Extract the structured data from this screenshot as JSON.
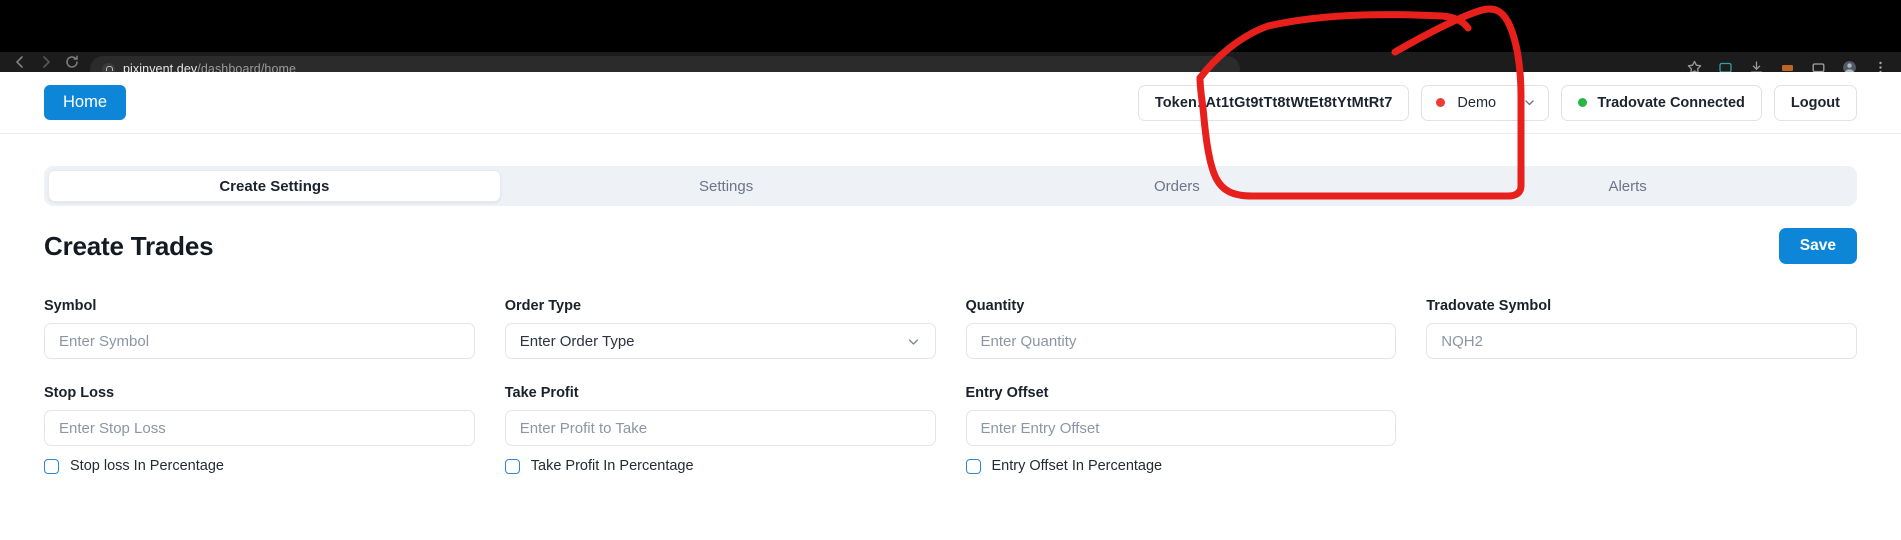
{
  "browser": {
    "url_host": "pixinvent.dev",
    "url_path": "/dashboard/home",
    "back_icon": "back-arrow-icon",
    "forward_icon": "forward-arrow-icon",
    "reload_icon": "reload-icon",
    "lock_icon": "lock-icon",
    "extensions_icon": "puzzle-piece-icon",
    "bookmark_icon": "star-icon",
    "profile_icon": "profile-avatar-icon",
    "menu_icon": "kebab-menu-icon"
  },
  "header": {
    "home_label": "Home",
    "token_label": "Token: At1tGt9tTt8tWtEt8tYtMtRt7",
    "env_value": "Demo",
    "env_dot_color": "#ef3b35",
    "connection_label": "Tradovate Connected",
    "connection_dot_color": "#28b446",
    "logout_label": "Logout",
    "chevron_icon": "chevron-down-icon"
  },
  "tabs": [
    {
      "label": "Create Settings",
      "active": true
    },
    {
      "label": "Settings",
      "active": false
    },
    {
      "label": "Orders",
      "active": false
    },
    {
      "label": "Alerts",
      "active": false
    }
  ],
  "main": {
    "title": "Create Trades",
    "save_label": "Save"
  },
  "fields": {
    "symbol": {
      "label": "Symbol",
      "placeholder": "Enter Symbol",
      "value": ""
    },
    "order_type": {
      "label": "Order Type",
      "placeholder": "Enter Order Type",
      "value": "",
      "icon": "chevron-down-icon"
    },
    "quantity": {
      "label": "Quantity",
      "placeholder": "Enter Quantity",
      "value": ""
    },
    "tradovate_symbol": {
      "label": "Tradovate Symbol",
      "placeholder": "NQH2",
      "value": ""
    },
    "stop_loss": {
      "label": "Stop Loss",
      "placeholder": "Enter Stop Loss",
      "value": ""
    },
    "take_profit": {
      "label": "Take Profit",
      "placeholder": "Enter Profit to Take",
      "value": ""
    },
    "entry_offset": {
      "label": "Entry Offset",
      "placeholder": "Enter Entry Offset",
      "value": ""
    }
  },
  "checkboxes": {
    "stop_loss_pct": {
      "label": "Stop loss In Percentage",
      "checked": false
    },
    "take_profit_pct": {
      "label": "Take Profit In Percentage",
      "checked": false
    },
    "entry_offset_pct": {
      "label": "Entry Offset In Percentage",
      "checked": false
    }
  },
  "annotation": {
    "color": "#e8201c",
    "shape": "hand-drawn-red-loop-around-token-and-environment-controls"
  },
  "theme": {
    "accent": "#0d86d8",
    "tabs_bg": "#eef2f7",
    "border": "#e2e6ec",
    "text": "#1a212b",
    "muted": "#8c96a3"
  }
}
